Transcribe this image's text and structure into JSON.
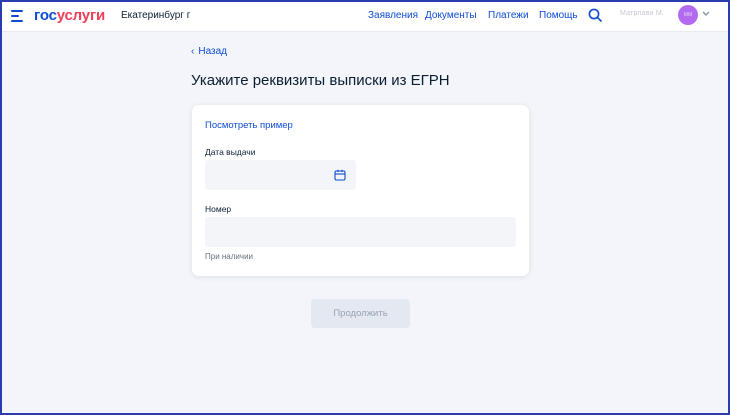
{
  "header": {
    "logo_part1": "гос",
    "logo_part2": "услуги",
    "city": "Екатеринбург г",
    "nav": [
      "Заявления",
      "Документы",
      "Платежи",
      "Помощь"
    ],
    "username": "Матрлави М.",
    "avatar_initials": "ММ",
    "colors": {
      "brand_blue": "#0d4cd3",
      "brand_red": "#ee3f58",
      "avatar": "#b26bf0"
    }
  },
  "back_link": "Назад",
  "page_title": "Укажите реквизиты выписки из ЕГРН",
  "form": {
    "sample_link": "Посмотреть пример",
    "date_label": "Дата выдачи",
    "date_value": "",
    "number_label": "Номер",
    "number_value": "",
    "number_hint": "При наличии"
  },
  "continue_button": "Продолжить"
}
